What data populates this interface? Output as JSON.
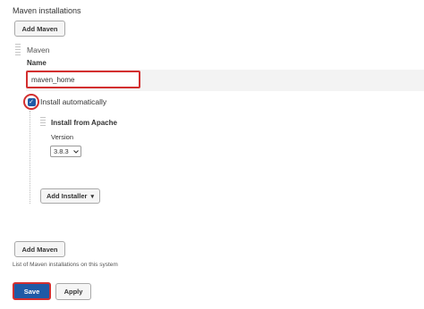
{
  "section_title": "Maven installations",
  "add_maven_top": "Add Maven",
  "installation": {
    "header": "Maven",
    "name_label": "Name",
    "name_value": "maven_home",
    "install_auto_label": "Install automatically",
    "installer": {
      "title": "Install from Apache",
      "version_label": "Version",
      "version_value": "3.8.3",
      "chevron": "chevron-down-icon"
    },
    "add_installer_label": "Add Installer",
    "add_installer_arrow": "▾"
  },
  "add_maven_bottom": "Add Maven",
  "help_text": "List of Maven installations on this system",
  "footer": {
    "save_label": "Save",
    "apply_label": "Apply"
  },
  "colors": {
    "accent": "#1f5aa6",
    "highlight": "#d32f2f"
  }
}
